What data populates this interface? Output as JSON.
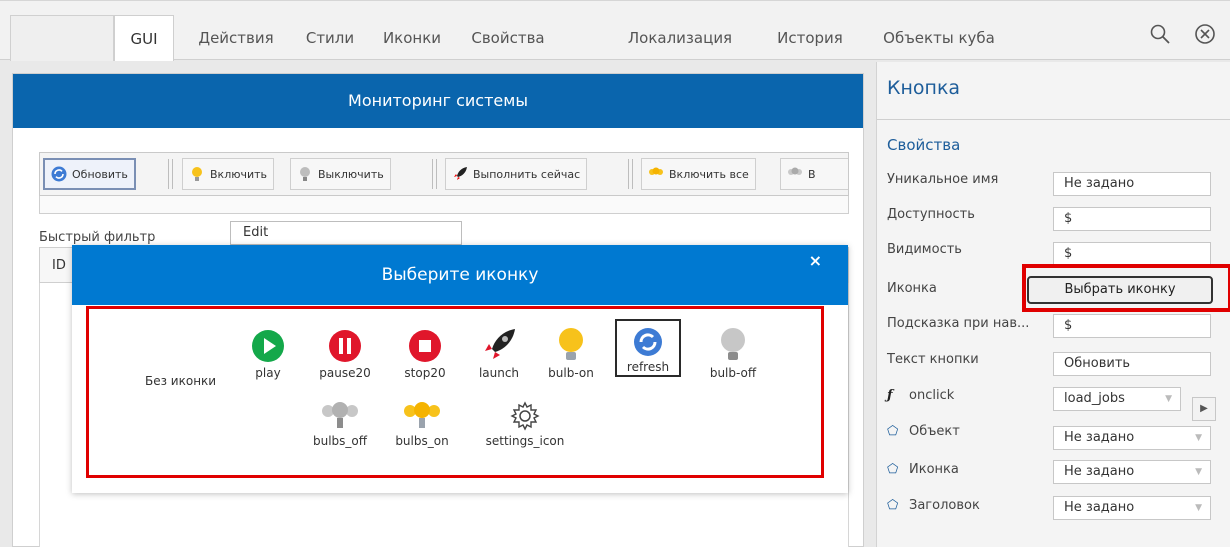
{
  "tabs": [
    {
      "label": "GUI",
      "active": true
    },
    {
      "label": "Действия"
    },
    {
      "label": "Стили"
    },
    {
      "label": "Иконки"
    },
    {
      "label": "Свойства"
    },
    {
      "label": "Локализация"
    },
    {
      "label": "История"
    },
    {
      "label": "Объекты куба"
    }
  ],
  "main": {
    "title": "Мониторинг системы",
    "toolbar": {
      "refresh": "Обновить",
      "enable": "Включить",
      "disable": "Выключить",
      "run_now": "Выполнить сейчас",
      "enable_all": "Включить все",
      "disable_all_cut": "В"
    },
    "filter_label": "Быстрый фильтр",
    "filter_value": "Edit",
    "grid_col_id": "ID"
  },
  "dialog": {
    "title": "Выберите иконку",
    "close": "×",
    "no_icon": "Без иконки",
    "icons": [
      {
        "label": "play",
        "icon": "play-icon"
      },
      {
        "label": "pause20",
        "icon": "pause-icon"
      },
      {
        "label": "stop20",
        "icon": "stop-icon"
      },
      {
        "label": "launch",
        "icon": "rocket-icon"
      },
      {
        "label": "bulb-on",
        "icon": "bulb-on-icon"
      },
      {
        "label": "refresh",
        "icon": "refresh-icon",
        "selected": true
      },
      {
        "label": "bulb-off",
        "icon": "bulb-off-icon"
      },
      {
        "label": "bulbs_off",
        "icon": "bulbs-off-icon"
      },
      {
        "label": "bulbs_on",
        "icon": "bulbs-on-icon"
      },
      {
        "label": "settings_icon",
        "icon": "gear-icon"
      }
    ]
  },
  "panel": {
    "title": "Кнопка",
    "section": "Свойства",
    "props": {
      "unique_name_label": "Уникальное имя",
      "unique_name_value": "Не задано",
      "availability_label": "Доступность",
      "availability_value": "$",
      "visibility_label": "Видимость",
      "visibility_value": "$",
      "icon_label": "Иконка",
      "icon_button": "Выбрать иконку",
      "tooltip_label": "Подсказка при нав...",
      "tooltip_value": "$",
      "button_text_label": "Текст кнопки",
      "button_text_value": "Обновить",
      "onclick_label": "onclick",
      "onclick_value": "load_jobs",
      "object_label": "Объект",
      "object_value": "Не задано",
      "icon2_label": "Иконка",
      "icon2_value": "Не задано",
      "header_label": "Заголовок",
      "header_value": "Не задано"
    }
  },
  "colors": {
    "header_blue": "#0a65ad",
    "dialog_blue": "#0079d1",
    "highlight_red": "#e00000"
  }
}
